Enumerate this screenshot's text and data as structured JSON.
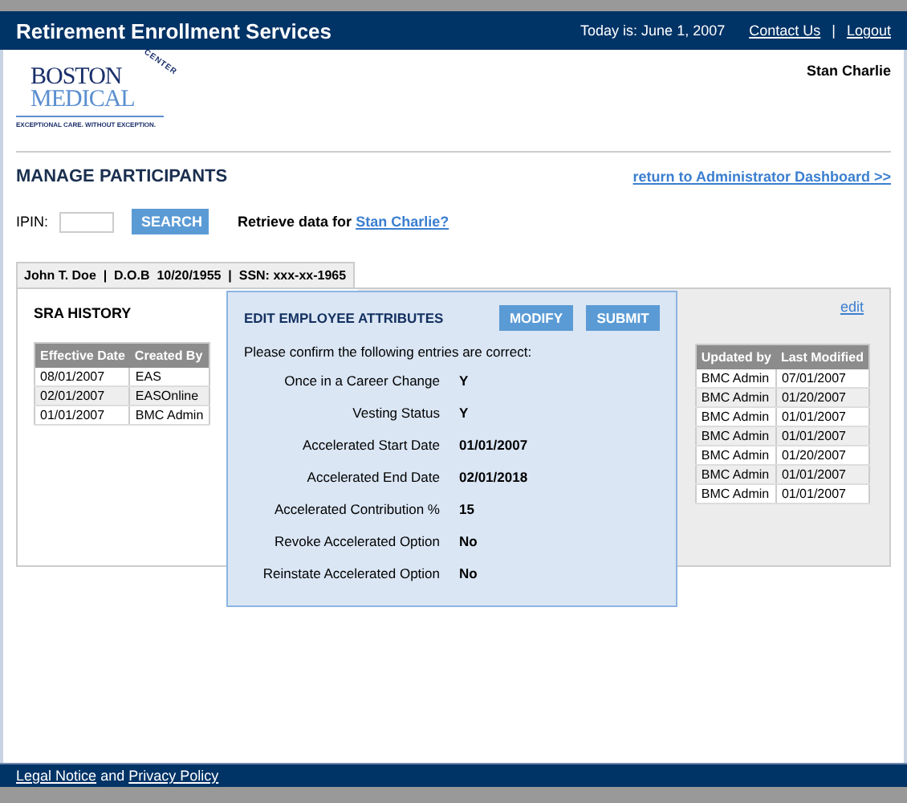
{
  "header": {
    "title": "Retirement Enrollment Services",
    "date": "Today is: June 1, 2007",
    "links": [
      "Contact Us",
      "Logout"
    ],
    "separator": "|"
  },
  "user": "Stan Charlie",
  "logo": {
    "line1": "BOSTON",
    "line2": "MEDICAL",
    "arc": "CENTER",
    "tagline": "EXCEPTIONAL CARE. WITHOUT EXCEPTION."
  },
  "page_title": "MANAGE PARTICIPANTS",
  "dashboard_link": "return to Administrator Dashboard >>",
  "search": {
    "label": "IPIN:",
    "button": "SEARCH",
    "retrieve_text": "Retrieve data for",
    "retrieve_link": "Stan Charlie?"
  },
  "record_header": "John T. Doe  |  D.O.B  10/20/1955  |  SSN: xxx-xx-1965",
  "sra_history": {
    "title": "SRA HISTORY",
    "columns": [
      "Effective Date",
      "Created By"
    ],
    "rows": [
      [
        "08/01/2007",
        "EAS"
      ],
      [
        "02/01/2007",
        "EASOnline"
      ],
      [
        "01/01/2007",
        "BMC Admin"
      ]
    ]
  },
  "attributes": {
    "edit_link": "edit",
    "columns": [
      "Updated by",
      "Last Modified"
    ],
    "rows": [
      [
        "BMC Admin",
        "07/01/2007"
      ],
      [
        "BMC Admin",
        "01/20/2007"
      ],
      [
        "BMC Admin",
        "01/01/2007"
      ],
      [
        "BMC Admin",
        "01/01/2007"
      ],
      [
        "BMC Admin",
        "01/20/2007"
      ],
      [
        "BMC Admin",
        "01/01/2007"
      ],
      [
        "BMC Admin",
        "01/01/2007"
      ]
    ]
  },
  "dialog": {
    "title": "EDIT EMPLOYEE ATTRIBUTES",
    "buttons": [
      "MODIFY",
      "SUBMIT"
    ],
    "prompt": "Please confirm the following entries are correct:",
    "fields": [
      {
        "label": "Once in a Career Change",
        "value": "Y"
      },
      {
        "label": "Vesting Status",
        "value": "Y"
      },
      {
        "label": "Accelerated Start Date",
        "value": "01/01/2007"
      },
      {
        "label": "Accelerated End Date",
        "value": "02/01/2018"
      },
      {
        "label": "Accelerated Contribution %",
        "value": "15"
      },
      {
        "label": "Revoke Accelerated Option",
        "value": "No"
      },
      {
        "label": "Reinstate Accelerated Option",
        "value": "No"
      }
    ]
  },
  "footer": {
    "links": [
      "Legal Notice",
      "Privacy Policy"
    ],
    "joiner": "and"
  }
}
